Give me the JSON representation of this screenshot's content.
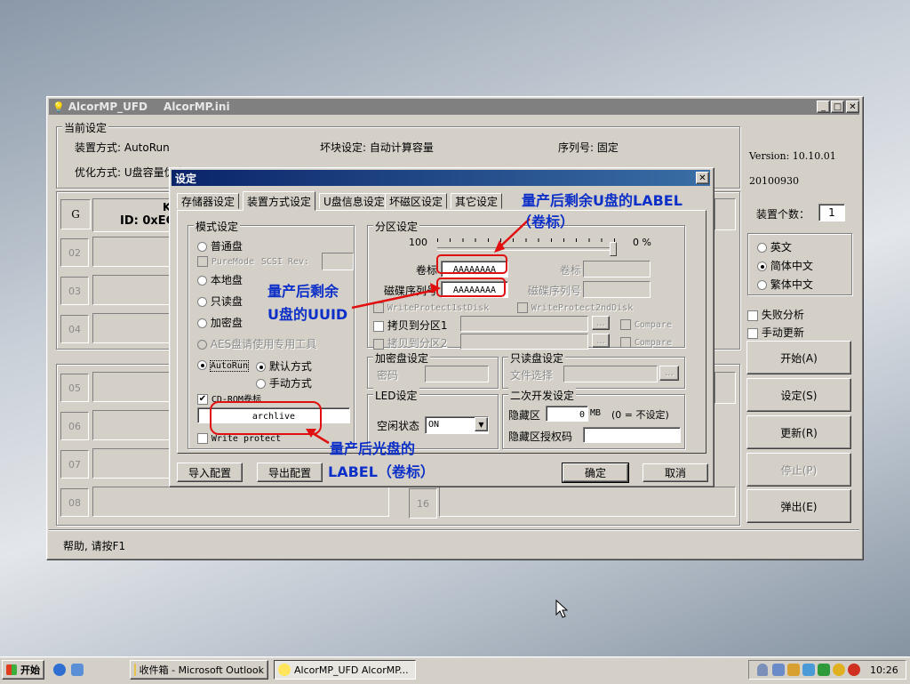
{
  "main_window": {
    "title_app": "AlcorMP_UFD",
    "title_file": "AlcorMP.ini",
    "current_settings_label": "当前设定",
    "device_mode": "装置方式: AutoRun",
    "bad_block": "坏块设定: 自动计算容量",
    "serial": "序列号: 固定",
    "optimize": "优化方式: U盘容量优先",
    "version": "Version: 10.10.01",
    "date": "20100930",
    "device_count_label": "装置个数：",
    "device_count": "1",
    "slot_g": "G",
    "slot_g_line1": "K",
    "slot_g_line2": "ID: 0xEC",
    "slots_left": [
      "02",
      "03",
      "04",
      "05",
      "06",
      "07",
      "08"
    ],
    "slot_16": "16",
    "lang_en": "英文",
    "lang_sc": "简体中文",
    "lang_tc": "繁体中文",
    "fail_analysis": "失败分析",
    "manual_update": "手动更新",
    "btn_start": "开始(A)",
    "btn_settings": "设定(S)",
    "btn_update": "更新(R)",
    "btn_stop": "停止(P)",
    "btn_eject": "弹出(E)",
    "status": "帮助, 请按F1"
  },
  "dialog": {
    "title": "设定",
    "tabs": [
      "存储器设定",
      "装置方式设定",
      "U盘信息设定",
      "坏磁区设定",
      "其它设定"
    ],
    "mode_group": "模式设定",
    "mode_normal": "普通盘",
    "puremode": "PureMode",
    "scsi_rev": "SCSI Rev:",
    "mode_local": "本地盘",
    "mode_readonly": "只读盘",
    "mode_encrypt": "加密盘",
    "aes_note": "AES盘请使用专用工具",
    "autorun": "AutoRun",
    "default_way": "默认方式",
    "manual_way": "手动方式",
    "cdrom_label": "CD-ROM卷标",
    "cdrom_value": "archlive",
    "write_protect": "Write protect",
    "partition_group": "分区设定",
    "slider_left": "100",
    "slider_right": "0 %",
    "volume_label": "卷标",
    "volume_value": "AAAAAAAA",
    "volume_label2": "卷标",
    "disk_serial_label": "磁碟序列号",
    "disk_serial_value": "AAAAAAAA",
    "disk_serial_label2": "磁碟序列号",
    "wp_first": "WriteProtect1stDisk",
    "wp_second": "WriteProtect2ndDisk",
    "copy_part1": "拷贝到分区1",
    "copy_part2": "拷贝到分区2",
    "compare": "Compare",
    "browse": "...",
    "encrypt_group": "加密盘设定",
    "password": "密码",
    "readonly_group": "只读盘设定",
    "file_select": "文件选择",
    "led_group": "LED设定",
    "idle_state": "空闲状态",
    "idle_value": "ON",
    "second_dev_group": "二次开发设定",
    "hidden_area": "隐藏区",
    "hidden_value": "0",
    "hidden_unit": "MB",
    "hidden_note": "(0 = 不设定)",
    "hidden_auth": "隐藏区授权码",
    "import_cfg": "导入配置",
    "export_cfg": "导出配置",
    "ok": "确定",
    "cancel": "取消"
  },
  "annotations": {
    "label_line1": "量产后剩余U盘的LABEL",
    "label_line2": "（卷标）",
    "uuid_line1": "量产后剩余",
    "uuid_line2": "U盘的UUID",
    "cd_line1": "量产后光盘的",
    "cd_line2": "LABEL（卷标）"
  },
  "taskbar": {
    "start": "开始",
    "task1": "收件箱 - Microsoft Outlook",
    "task2": "AlcorMP_UFD      AlcorMP...",
    "clock": "10:26"
  }
}
